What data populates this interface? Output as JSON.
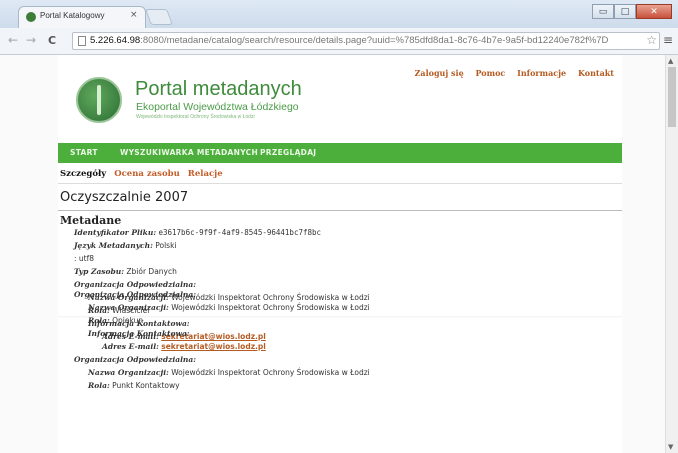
{
  "browser": {
    "tab_title": "Portal Katalogowy",
    "tab_close": "×",
    "url_host": "5.226.64.98",
    "url_rest": ":8080/metadane/catalog/search/resource/details.page?uuid=%785dfd8da1-8c76-4b7e-9a5f-bd12240e782f%7D",
    "star": "☆",
    "menu": "≡",
    "back": "←",
    "forward": "→",
    "reload": "C",
    "minimize": "▭",
    "maximize": "□",
    "close": "✕"
  },
  "header": {
    "links": [
      "Zaloguj się",
      "Pomoc",
      "Informacje",
      "Kontakt"
    ],
    "title": "Portal metadanych",
    "subtitle": "Ekoportal Województwa Łódzkiego",
    "subtitle2": "Wojewódzki Inspektorat Ochrony Środowiska w Łodzi"
  },
  "nav": [
    "START",
    "WYSZUKIWARKA METADANYCH",
    "PRZEGLĄDAJ"
  ],
  "subtabs": {
    "active": "Szczegóły",
    "items": [
      "Ocena zasobu",
      "Relacje"
    ]
  },
  "page_title": "Oczyszczalnie 2007",
  "section": "Metadane",
  "rows": {
    "r1": {
      "k": "Identyfikator Pliku:",
      "v": "e3617b6c-9f9f-4af9-8545-96441bc7f8bc"
    },
    "r2": {
      "k": "Język Metadanych:",
      "v": "Polski"
    },
    "r3": {
      "k": "",
      "v": ": utf8"
    },
    "r4": {
      "k": "Typ Zasobu:",
      "v": "Zbiór Danych"
    },
    "r5": {
      "k": "Organizacja Odpowiedzialna:",
      "v": ""
    },
    "r6": {
      "k": "Nazwa Organizacji:",
      "v": "Wojewódzki Inspektorat Ochrony Środowiska w Łodzi"
    },
    "r7": {
      "k": "Rola:",
      "v": "Właściciel"
    },
    "r8": {
      "k": "Informacja Kontaktowa:",
      "v": ""
    },
    "r9": {
      "k": "Adres E-mail:",
      "v": "sekretariat@wios.lodz.pl"
    },
    "r10": {
      "k": "Organizacja Odpowiedzialna:",
      "v": ""
    },
    "r11": {
      "k": "Nazwa Organizacji:",
      "v": "Wojewódzki Inspektorat Ochrony Środowiska w Łodzi"
    },
    "r12": {
      "k": "Rola:",
      "v": "Opiekun"
    },
    "r13": {
      "k": "Informacja Kontaktowa:",
      "v": ""
    },
    "r14": {
      "k": "Adres E-mail:",
      "v": "sekretariat@wios.lodz.pl"
    },
    "r15": {
      "k": "Organizacja Odpowiedzialna:",
      "v": ""
    },
    "r16": {
      "k": "Nazwa Organizacji:",
      "v": "Wojewódzki Inspektorat Ochrony Środowiska w Łodzi"
    },
    "r17": {
      "k": "Rola:",
      "v": "Punkt Kontaktowy"
    }
  },
  "colors": {
    "nav_green": "#4caf3c",
    "title_green": "#3e8b3b",
    "link_orange": "#b45b22"
  }
}
